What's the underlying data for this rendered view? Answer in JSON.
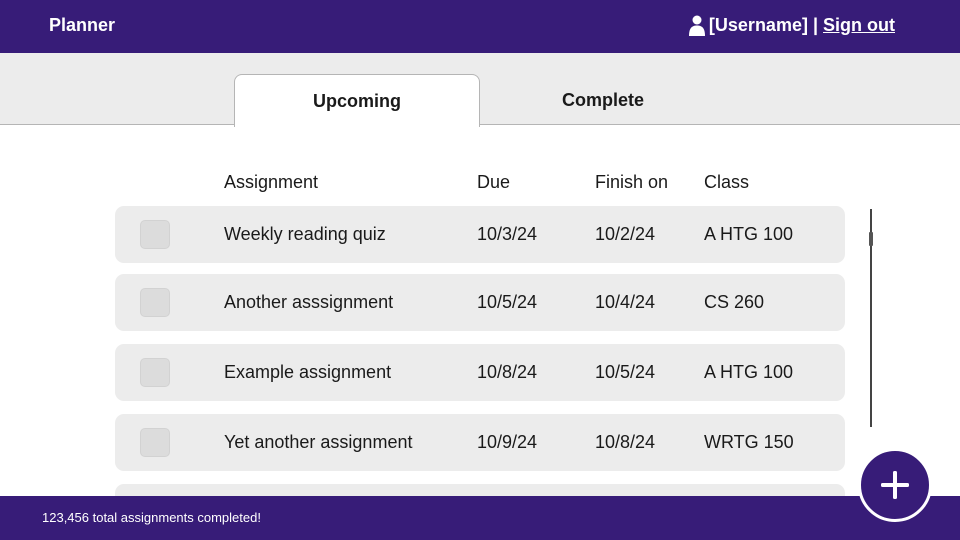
{
  "header": {
    "brand": "Planner",
    "username": "[Username]",
    "separator": "|",
    "sign_out": "Sign out"
  },
  "tabs": {
    "upcoming": "Upcoming",
    "complete": "Complete",
    "active": "upcoming"
  },
  "table": {
    "columns": {
      "assignment": "Assignment",
      "due": "Due",
      "finish_on": "Finish on",
      "class": "Class"
    },
    "rows": [
      {
        "assignment": "Weekly reading quiz",
        "due": "10/3/24",
        "finish_on": "10/2/24",
        "class": "A HTG 100"
      },
      {
        "assignment": "Another asssignment",
        "due": "10/5/24",
        "finish_on": "10/4/24",
        "class": "CS 260"
      },
      {
        "assignment": "Example assignment",
        "due": "10/8/24",
        "finish_on": "10/5/24",
        "class": "A HTG 100"
      },
      {
        "assignment": "Yet another assignment",
        "due": "10/9/24",
        "finish_on": "10/8/24",
        "class": "WRTG 150"
      }
    ]
  },
  "footer": {
    "status": "123,456 total assignments completed!"
  },
  "fab": {
    "icon": "plus-icon"
  },
  "colors": {
    "brand": "#371c78",
    "row_bg": "#ececec",
    "tabstrip_bg": "#ececec"
  }
}
